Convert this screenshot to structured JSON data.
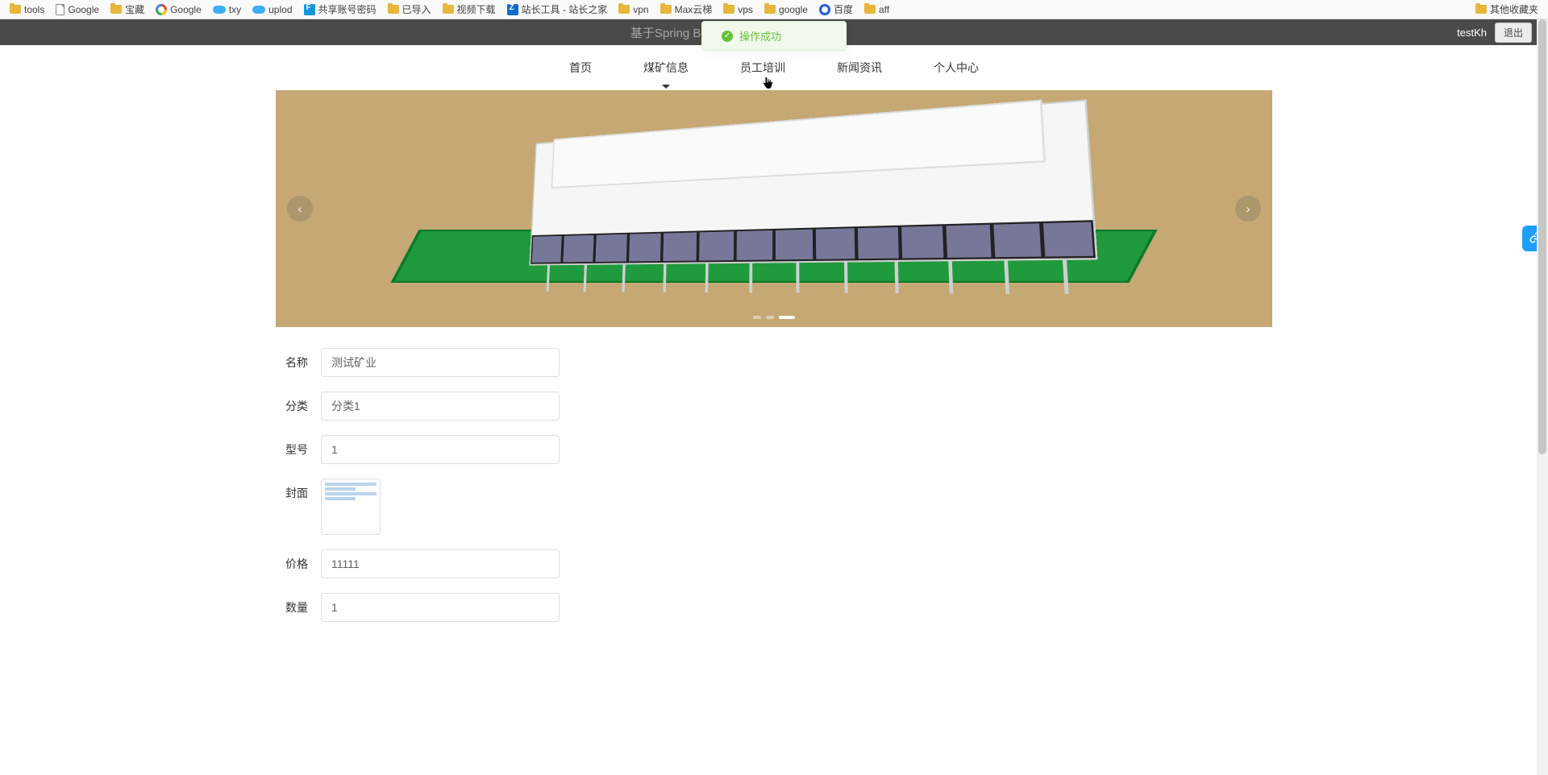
{
  "bookmarks": {
    "left": [
      {
        "icon": "folder",
        "label": "tools"
      },
      {
        "icon": "page",
        "label": "Google"
      },
      {
        "icon": "folder",
        "label": "宝藏"
      },
      {
        "icon": "g",
        "label": "Google"
      },
      {
        "icon": "cloud",
        "label": "txy"
      },
      {
        "icon": "cloud",
        "label": "uplod"
      },
      {
        "icon": "fd",
        "label": "共享账号密码"
      },
      {
        "icon": "folder",
        "label": "已导入"
      },
      {
        "icon": "folder",
        "label": "视频下载"
      },
      {
        "icon": "zz",
        "label": "站长工具 - 站长之家"
      },
      {
        "icon": "folder",
        "label": "vpn"
      },
      {
        "icon": "folder",
        "label": "Max云梯"
      },
      {
        "icon": "folder",
        "label": "vps"
      },
      {
        "icon": "folder",
        "label": "google"
      },
      {
        "icon": "paw",
        "label": "百度"
      },
      {
        "icon": "folder",
        "label": "aff"
      }
    ],
    "right": {
      "icon": "folder",
      "label": "其他收藏夹"
    }
  },
  "header": {
    "title": "基于Spring Boot的煤矿信息管理系统",
    "user": "testKh",
    "logout": "退出"
  },
  "toast": {
    "text": "操作成功"
  },
  "nav": {
    "items": [
      "首页",
      "煤矿信息",
      "员工培训",
      "新闻资讯",
      "个人中心"
    ],
    "active_index": 1
  },
  "carousel": {
    "dots": 3,
    "active_dot": 2
  },
  "form": {
    "fields": [
      {
        "label": "名称",
        "value": "测试矿业"
      },
      {
        "label": "分类",
        "value": "分类1"
      },
      {
        "label": "型号",
        "value": "1"
      },
      {
        "label": "封面",
        "value": ""
      },
      {
        "label": "价格",
        "value": "11111"
      },
      {
        "label": "数量",
        "value": "1"
      }
    ]
  }
}
